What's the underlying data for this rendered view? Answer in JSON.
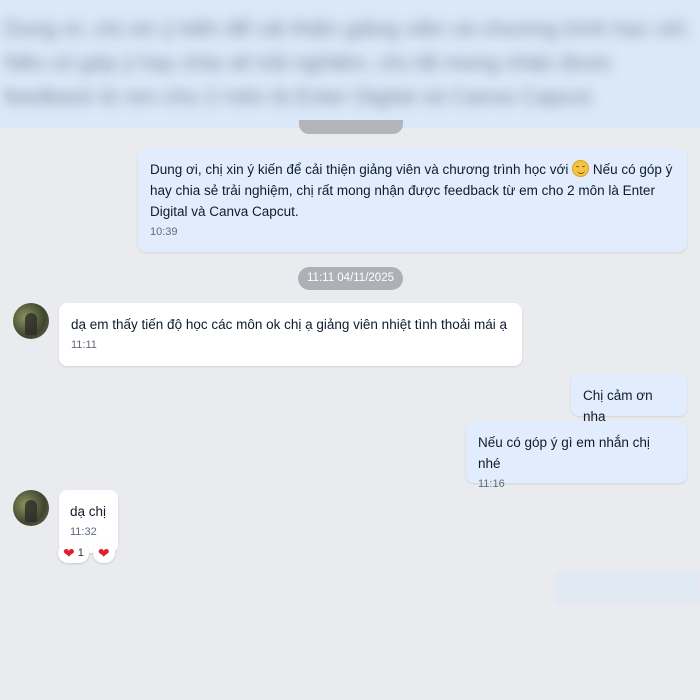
{
  "top_blurred": {
    "text": "Dung ơi, chị xin ý kiến để cải thiện giảng viên và chương trình học với. Nếu có góp ý hay chia sẻ trải nghiệm, chị rất mong nhận được feedback từ em cho 2 môn là Enter Digital và Canva Capcut."
  },
  "messages": [
    {
      "sender": "me",
      "text_part1": "Dung ơi, chị xin ý kiến để cải thiện giảng viên và chương trình học với",
      "text_part2": " Nếu có góp ý hay chia sẻ trải nghiệm, chị rất mong nhận được feedback từ em cho 2 môn là Enter Digital và Canva Capcut.",
      "emoji": "smiling-face-emoji",
      "time": "10:39"
    },
    {
      "sender": "them",
      "text": "dạ em thấy tiến độ học các môn ok chị ạ giảng viên nhiệt tình thoải mái ạ",
      "time": "11:11"
    },
    {
      "sender": "me",
      "text": "Chị cảm ơn nha",
      "time": ""
    },
    {
      "sender": "me",
      "text": "Nếu có góp ý gì em nhắn chị nhé",
      "time": "11:16"
    },
    {
      "sender": "them",
      "text": "dạ chị",
      "time": "11:32",
      "reactions": [
        {
          "icon": "heart-icon",
          "count": "1"
        },
        {
          "icon": "heart-icon",
          "count": ""
        }
      ]
    }
  ],
  "date_separator": "11:11 04/11/2025",
  "colors": {
    "background": "#e9ebef",
    "my_bubble": "#e1edfd",
    "their_bubble": "#ffffff",
    "date_pill": "#adb0b6",
    "heart": "#e0202e"
  }
}
